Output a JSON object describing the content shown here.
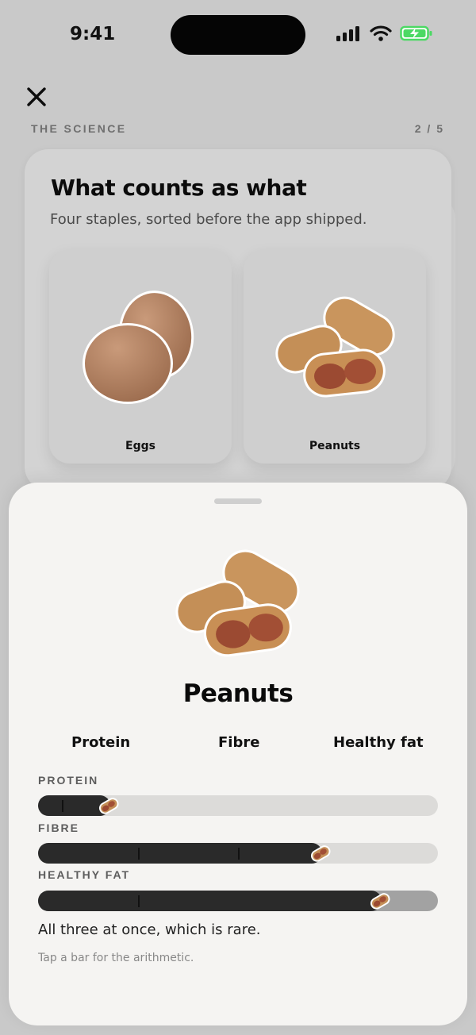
{
  "status_bar": {
    "time": "9:41"
  },
  "header": {
    "section": "THE SCIENCE",
    "step": "2 / 5"
  },
  "card": {
    "title": "What counts as what",
    "subtitle": "Four staples, sorted before the app shipped.",
    "tiles": [
      {
        "label": "Eggs",
        "icon": "eggs-icon"
      },
      {
        "label": "Peanuts",
        "icon": "peanuts-icon"
      }
    ]
  },
  "sheet": {
    "title": "Peanuts",
    "icon": "peanuts-icon",
    "tags": [
      "Protein",
      "Fibre",
      "Healthy fat"
    ],
    "bars": [
      {
        "label": "PROTEIN",
        "level": 0.18,
        "tick_count": 1
      },
      {
        "label": "FIBRE",
        "level": 0.71,
        "tick_count": 2
      },
      {
        "label": "HEALTHY FAT",
        "level": 0.86,
        "tick_count": 1
      }
    ],
    "verdict": "All three at once, which is rare.",
    "hint": "Tap a bar for the arithmetic."
  },
  "colors": {
    "background": "#c9c9c9",
    "sheet": "#f5f4f2",
    "bar_fill": "#2a2a2a",
    "bar_track": "#dcdbd9",
    "battery": "#4cd964"
  }
}
